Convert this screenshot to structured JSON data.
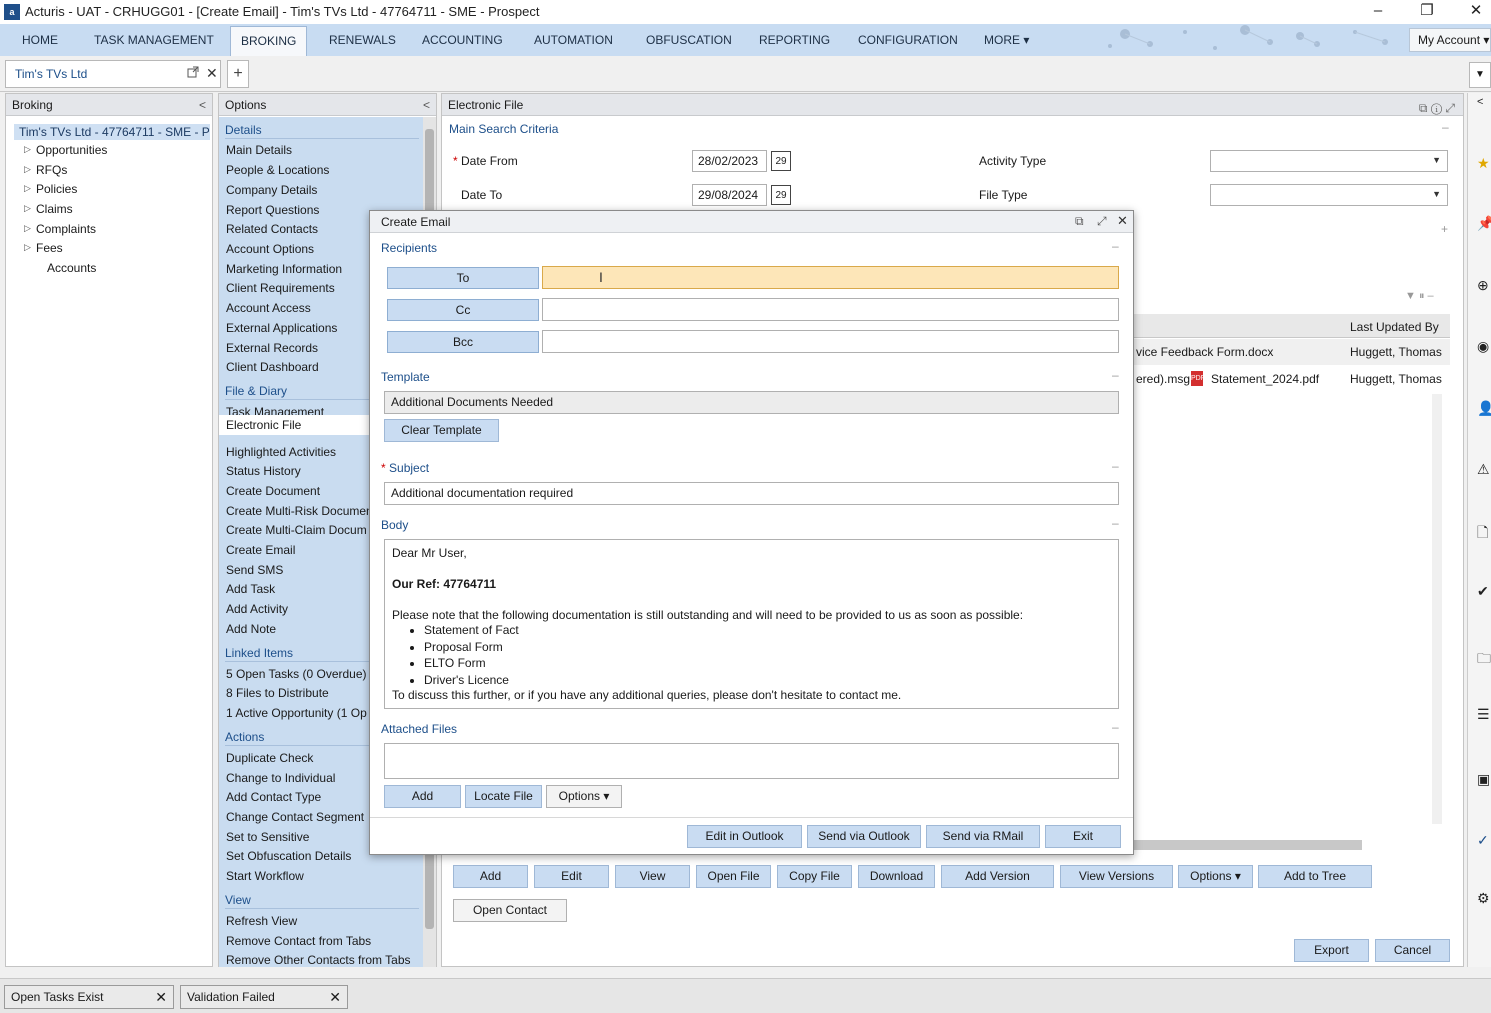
{
  "window": {
    "title": "Acturis - UAT - CRHUGG01 - [Create Email] - Tim's TVs Ltd - 47764711 - SME - Prospect",
    "app_icon_text": "a",
    "minimize": "–",
    "restore": "❐",
    "close": "✕"
  },
  "nav": {
    "items": [
      "HOME",
      "TASK MANAGEMENT",
      "BROKING",
      "RENEWALS",
      "ACCOUNTING",
      "AUTOMATION",
      "OBFUSCATION",
      "REPORTING",
      "CONFIGURATION",
      "MORE ▾"
    ],
    "active": "BROKING",
    "my_account": "My Account ▾"
  },
  "contact_tab": {
    "label": "Tim's TVs Ltd",
    "popout_icon": "popout-icon",
    "close": "✕",
    "add": "+"
  },
  "broking": {
    "title": "Broking",
    "root": "Tim's TVs Ltd - 47764711 - SME - Pr",
    "items": [
      {
        "label": "Opportunities",
        "expandable": true
      },
      {
        "label": "RFQs",
        "expandable": true
      },
      {
        "label": "Policies",
        "expandable": true
      },
      {
        "label": "Claims",
        "expandable": true
      },
      {
        "label": "Complaints",
        "expandable": true
      },
      {
        "label": "Fees",
        "expandable": true
      },
      {
        "label": "Accounts",
        "expandable": false
      }
    ]
  },
  "options": {
    "title": "Options",
    "details_header": "Details",
    "details": [
      "Main Details",
      "People & Locations",
      "Company Details",
      "Report Questions",
      "Related Contacts",
      "Account Options",
      "Marketing Information",
      "Client Requirements",
      "Account Access",
      "External Applications",
      "External Records",
      "Client Dashboard"
    ],
    "file_diary_header": "File & Diary",
    "file_diary": [
      "Task Management",
      "Electronic File",
      "Highlighted Activities",
      "Status History",
      "Create Document",
      "Create Multi-Risk Documen",
      "Create Multi-Claim Docum",
      "Create Email",
      "Send SMS",
      "Add Task",
      "Add Activity",
      "Add Note"
    ],
    "selected": "Electronic File",
    "linked_header": "Linked Items",
    "linked": [
      "5 Open Tasks (0 Overdue)",
      "8 Files to Distribute",
      "1 Active Opportunity (1 Op"
    ],
    "actions_header": "Actions",
    "actions": [
      "Duplicate Check",
      "Change to Individual",
      "Add Contact Type",
      "Change Contact Segment",
      "Set to Sensitive",
      "Set Obfuscation Details",
      "Start Workflow"
    ],
    "view_header": "View",
    "view": [
      "Refresh View",
      "Remove Contact from Tabs",
      "Remove Other Contacts from Tabs"
    ]
  },
  "efile": {
    "title": "Electronic File",
    "main_search": "Main Search Criteria",
    "date_from_label": "Date From",
    "date_from": "28/02/2023",
    "date_to_label": "Date To",
    "date_to": "29/08/2024",
    "cal_day": "29",
    "activity_type_label": "Activity Type",
    "file_type_label": "File Type",
    "col_last_updated": "Last Updated By",
    "rows": [
      {
        "file": "vice Feedback Form.docx",
        "updated_by": "Huggett, Thomas"
      },
      {
        "file": "ered).msg;",
        "file2": "Statement_2024.pdf",
        "updated_by": "Huggett, Thomas"
      }
    ],
    "buttons": [
      "Add",
      "Edit",
      "View",
      "Open File",
      "Copy File",
      "Download",
      "Add Version",
      "View Versions",
      "Options ▾",
      "Add to Tree"
    ],
    "open_contact": "Open Contact",
    "export": "Export",
    "cancel": "Cancel"
  },
  "modal": {
    "title": "Create Email",
    "recipients": "Recipients",
    "to": "To",
    "cc": "Cc",
    "bcc": "Bcc",
    "template_label": "Template",
    "template_value": "Additional Documents Needed",
    "clear_template": "Clear Template",
    "subject_label": "Subject",
    "subject_value": "Additional documentation required",
    "body_label": "Body",
    "body": {
      "greeting": "Dear Mr User,",
      "ref": "Our Ref: 47764711",
      "intro": "Please note that the following documentation is still outstanding and will need to be provided to us as soon as possible:",
      "items": [
        "Statement of Fact",
        "Proposal Form",
        "ELTO Form",
        "Driver's Licence"
      ],
      "closing": "To discuss this further, or if you have any additional queries, please don't hesitate to contact me."
    },
    "attached_label": "Attached Files",
    "add": "Add",
    "locate_file": "Locate File",
    "options": "Options ▾",
    "edit_outlook": "Edit in Outlook",
    "send_outlook": "Send via Outlook",
    "send_rmail": "Send via RMail",
    "exit": "Exit",
    "collapse": "–"
  },
  "status": {
    "tab1": "Open Tasks Exist",
    "tab2": "Validation Failed",
    "close": "✕"
  }
}
